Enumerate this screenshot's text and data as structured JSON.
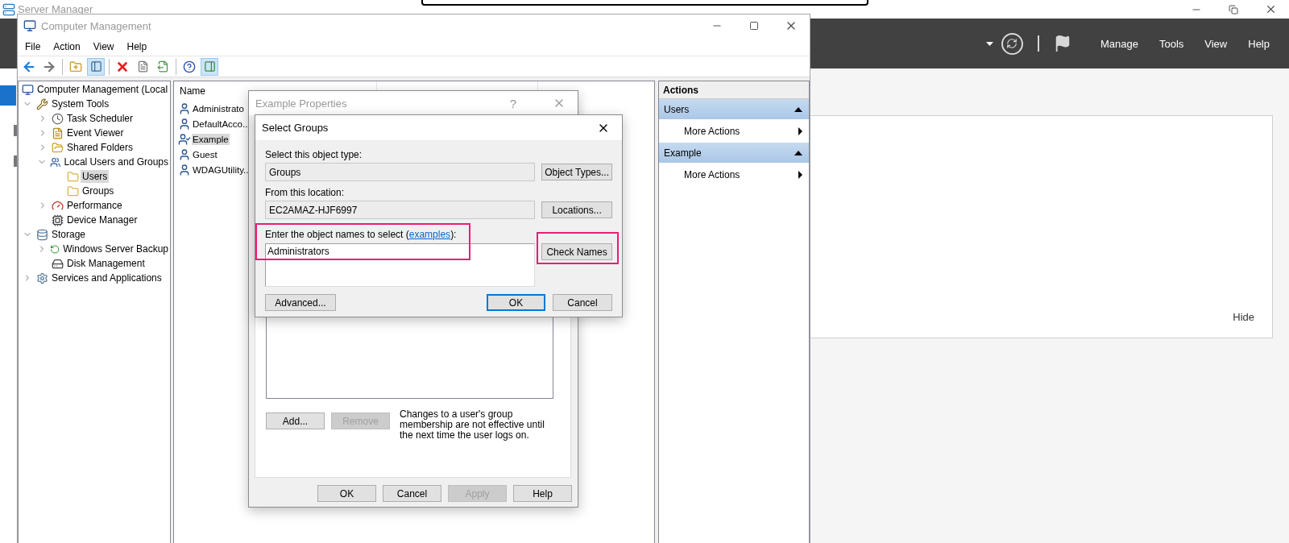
{
  "server_manager": {
    "title": "Server Manager",
    "menu": [
      "Manage",
      "Tools",
      "View",
      "Help"
    ],
    "panel_link": "Hide"
  },
  "computer_management": {
    "title": "Computer Management",
    "menu": [
      "File",
      "Action",
      "View",
      "Help"
    ],
    "toolbar": {
      "console_tree_shown": true,
      "action_pane_shown": true
    },
    "tree": [
      {
        "label": "Computer Management (Local",
        "selected": false,
        "children": [
          {
            "label": "System Tools",
            "expanded": true,
            "selected": false,
            "children": [
              {
                "label": "Task Scheduler",
                "expanded": false,
                "selected": false
              },
              {
                "label": "Event Viewer",
                "expanded": false,
                "selected": false
              },
              {
                "label": "Shared Folders",
                "expanded": false,
                "selected": false
              },
              {
                "label": "Local Users and Groups",
                "expanded": true,
                "selected": false,
                "children": [
                  {
                    "label": "Users",
                    "selected": true
                  },
                  {
                    "label": "Groups",
                    "selected": false
                  }
                ]
              },
              {
                "label": "Performance",
                "expanded": false,
                "selected": false
              },
              {
                "label": "Device Manager",
                "selected": false
              }
            ]
          },
          {
            "label": "Storage",
            "expanded": true,
            "selected": false,
            "children": [
              {
                "label": "Windows Server Backup",
                "expanded": false,
                "selected": false
              },
              {
                "label": "Disk Management",
                "selected": false
              }
            ]
          },
          {
            "label": "Services and Applications",
            "expanded": false,
            "selected": false
          }
        ]
      }
    ],
    "list": {
      "columns": [
        "Name"
      ],
      "rows": [
        {
          "name": "Administrato",
          "selected": false
        },
        {
          "name": "DefaultAcco..",
          "selected": false
        },
        {
          "name": "Example",
          "selected": true
        },
        {
          "name": "Guest",
          "selected": false
        },
        {
          "name": "WDAGUtility..",
          "selected": false
        }
      ]
    },
    "actions": {
      "title": "Actions",
      "sections": [
        {
          "title": "Users",
          "expanded": true,
          "items": [
            "More Actions"
          ]
        },
        {
          "title": "Example",
          "expanded": true,
          "items": [
            "More Actions"
          ]
        }
      ]
    }
  },
  "properties_dialog": {
    "title": "Example Properties",
    "context_help": "?",
    "list_buttons": [
      {
        "label": "Add...",
        "disabled": false
      },
      {
        "label": "Remove",
        "disabled": true
      }
    ],
    "note": "Changes to a user's group membership are not effective until the next time the user logs on.",
    "buttons": [
      {
        "label": "OK",
        "disabled": false
      },
      {
        "label": "Cancel",
        "disabled": false
      },
      {
        "label": "Apply",
        "disabled": true
      },
      {
        "label": "Help",
        "disabled": false
      }
    ]
  },
  "select_groups_dialog": {
    "title": "Select Groups",
    "object_type_label": "Select this object type:",
    "object_type": "Groups",
    "object_types_button": "Object Types...",
    "location_label": "From this location:",
    "location": "EC2AMAZ-HJF6997",
    "locations_button": "Locations...",
    "names_label": {
      "before": "Enter the object names to select (",
      "link": "examples",
      "after": "):"
    },
    "names_value": "Administrators",
    "check_names_button": "Check Names",
    "advanced_button": "Advanced...",
    "buttons": [
      {
        "label": "OK",
        "default": true
      },
      {
        "label": "Cancel",
        "default": false
      }
    ]
  }
}
